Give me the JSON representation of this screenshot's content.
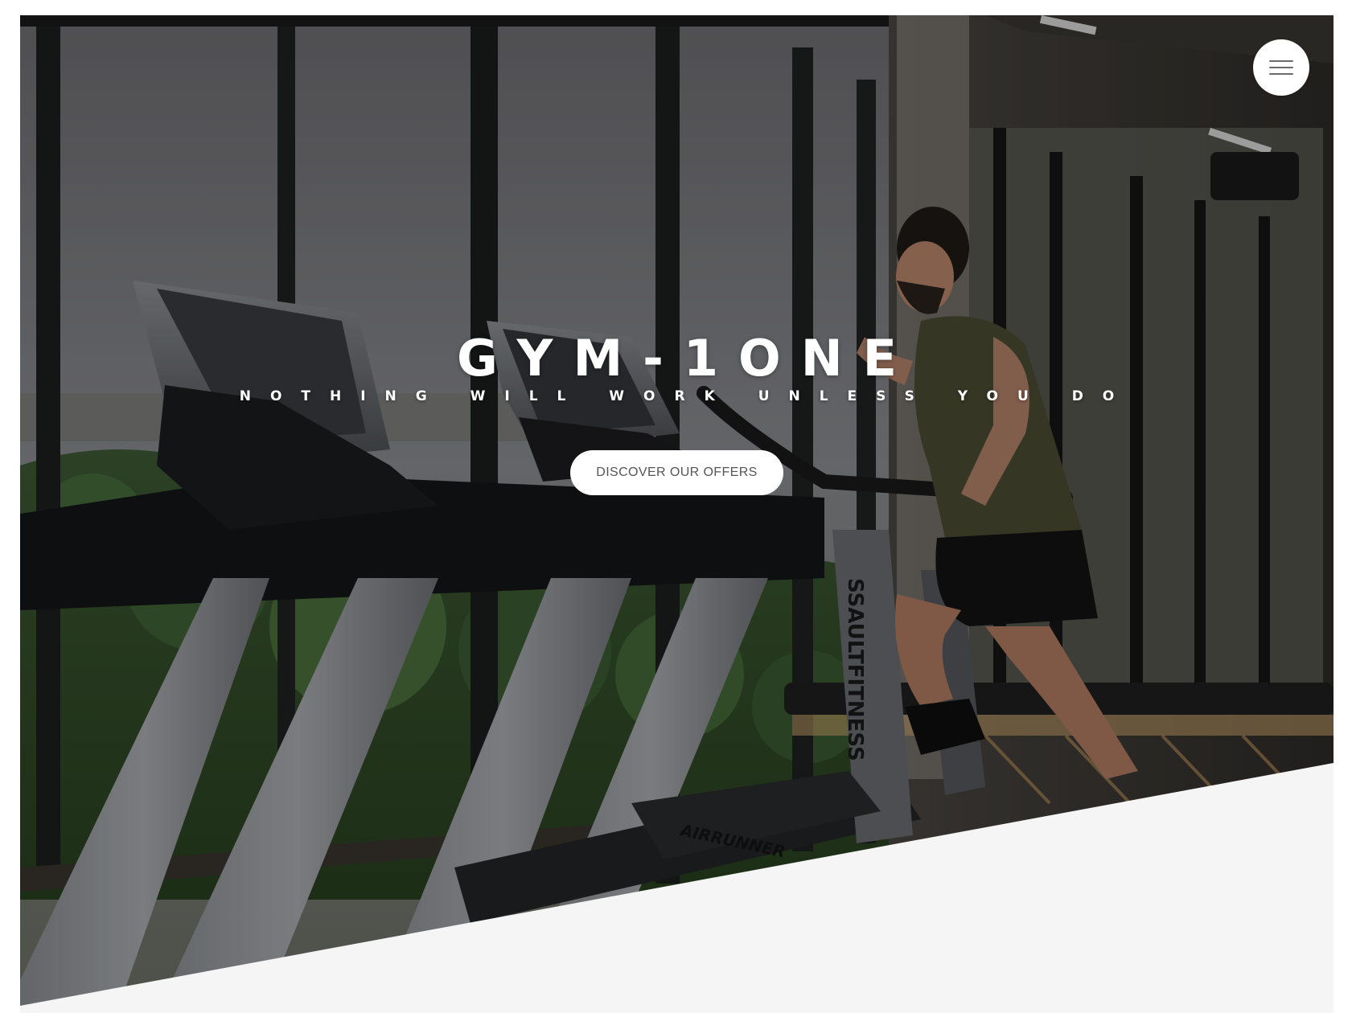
{
  "menu": {
    "icon": "hamburger-menu-icon"
  },
  "hero": {
    "title": "GYM-1ONE",
    "tagline": "NOTHING WILL WORK UNLESS YOU DO",
    "cta_label": "DISCOVER OUR OFFERS",
    "background_image": "treadmills-gym-runner-photo",
    "treadmill_brand_text": "SSAULTFITNESS",
    "treadmill_model_text": "AIRRUNNER"
  },
  "colors": {
    "overlay": "#000000",
    "section_background": "#f5f5f5",
    "button_background": "#ffffff",
    "button_text": "#555555",
    "title_text": "#ffffff"
  }
}
